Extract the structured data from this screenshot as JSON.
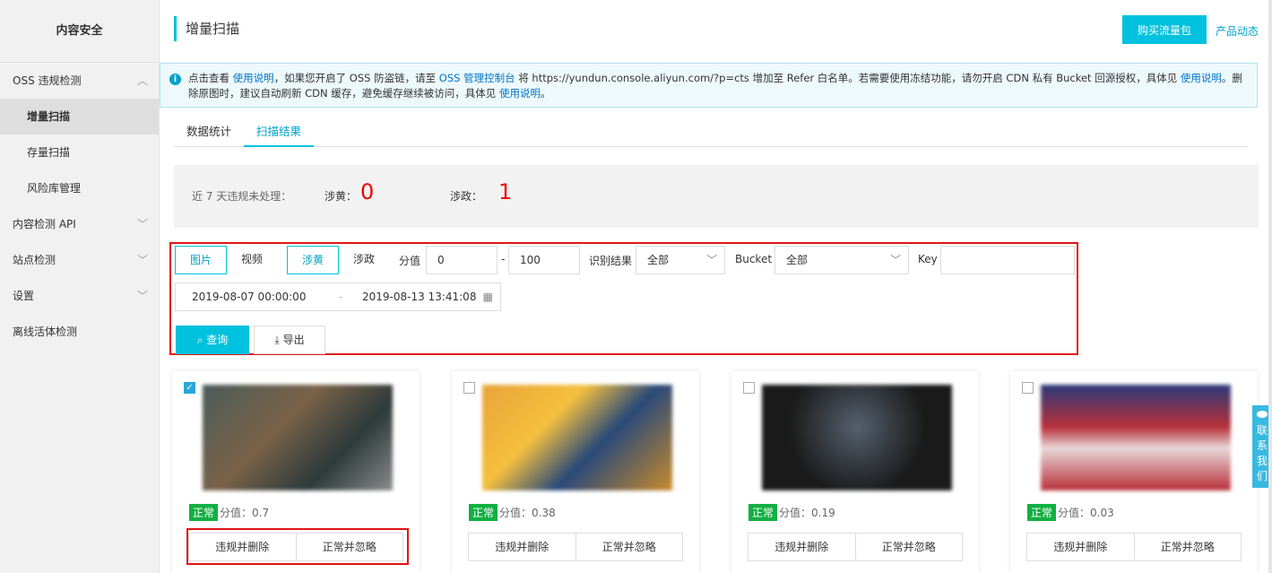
{
  "sidebar": {
    "title": "内容安全",
    "items": [
      {
        "label": "OSS 违规检测",
        "sub": false,
        "active": false,
        "chev": "︿"
      },
      {
        "label": "增量扫描",
        "sub": true,
        "active": true,
        "chev": ""
      },
      {
        "label": "存量扫描",
        "sub": true,
        "active": false,
        "chev": ""
      },
      {
        "label": "风险库管理",
        "sub": true,
        "active": false,
        "chev": ""
      },
      {
        "label": "内容检测 API",
        "sub": false,
        "active": false,
        "chev": "﹀"
      },
      {
        "label": "站点检测",
        "sub": false,
        "active": false,
        "chev": "﹀"
      },
      {
        "label": "设置",
        "sub": false,
        "active": false,
        "chev": "﹀"
      },
      {
        "label": "离线活体检测",
        "sub": false,
        "active": false,
        "chev": ""
      }
    ]
  },
  "header": {
    "title": "增量扫描",
    "buy_label": "购买流量包",
    "news_label": "产品动态"
  },
  "notice": {
    "p1": "点击查看 ",
    "l1": "使用说明",
    "p2": "，如果您开启了 OSS 防盗链，请至 ",
    "l2": "OSS 管理控制台",
    "p3": " 将 https://yundun.console.aliyun.com/?p=cts 增加至 Refer 白名单。若需要使用冻结功能，请勿开启 CDN 私有 Bucket 回源授权，具体见 ",
    "l3": "使用说明",
    "p4": "。删除原图时，建议自动刷新 CDN 缓存，避免缓存继续被访问，具体见 ",
    "l4": "使用说明",
    "p5": "。"
  },
  "tabs": [
    "数据统计",
    "扫描结果"
  ],
  "stats": {
    "label": "近 7 天违规未处理：",
    "porn_label": "涉黄：",
    "porn": "0",
    "terror_label": "涉政：",
    "terror": "1"
  },
  "filter": {
    "media": [
      "图片",
      "视频"
    ],
    "type": [
      "涉黄",
      "涉政"
    ],
    "score_label": "分值",
    "score_min": "0",
    "dash": "-",
    "score_max": "100",
    "result_label": "识别结果",
    "result": "全部",
    "bucket_label": "Bucket",
    "bucket": "全部",
    "key_label": "Key",
    "key": "",
    "date_start": "2019-08-07 00:00:00",
    "date_end": "2019-08-13 13:41:08",
    "query": "查询",
    "export": "导出"
  },
  "cards": [
    {
      "checked": true,
      "tag": "正常",
      "score": "分值：0.7",
      "a1": "违规并删除",
      "a2": "正常并忽略",
      "bg": "linear-gradient(135deg,#4b5d5a,#7a6248 40%,#2d3a3a 70%,#8a8a8a)"
    },
    {
      "checked": false,
      "tag": "正常",
      "score": "分值：0.38",
      "a1": "违规并删除",
      "a2": "正常并忽略",
      "bg": "linear-gradient(135deg,#e8a33a,#f5c03d 35%,#2a4a7a 60%,#c98a2a)"
    },
    {
      "checked": false,
      "tag": "正常",
      "score": "分值：0.19",
      "a1": "违规并删除",
      "a2": "正常并忽略",
      "bg": "radial-gradient(circle at 50% 40%,#55606e,#1a1a1a 60%)"
    },
    {
      "checked": false,
      "tag": "正常",
      "score": "分值：0.03",
      "a1": "违规并删除",
      "a2": "正常并忽略",
      "bg": "linear-gradient(180deg,#2a3a7a,#b8303a 40%,#e8d8d8 60%,#b8303a)"
    }
  ],
  "float_contact": [
    "联",
    "系",
    "我",
    "们"
  ]
}
